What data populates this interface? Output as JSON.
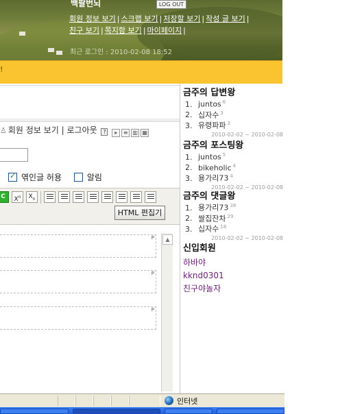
{
  "header": {
    "title": "백팔번뇌",
    "logout_label": "LOG OUT",
    "links_row1": [
      "회원 정보 보기",
      "스크랩 보기",
      "저장할 보기",
      "작성 글 보기"
    ],
    "links_row2": [
      "친구 보기",
      "쪽지함 보기",
      "마이페이지"
    ],
    "separator": "|",
    "last_login": "최근 로그인 : 2010-02-08 18:52"
  },
  "yellow_bar": {
    "marker": "!"
  },
  "member_bar": {
    "member_info": "회원 정보 보기",
    "separator": "|",
    "logout": "로그아웃",
    "help": "?"
  },
  "options": {
    "trackback_label": "엮인글 허용",
    "trackback_checked": true,
    "notify_label": "알림",
    "notify_checked": false
  },
  "toolbar": {
    "c_label": "C",
    "superscript_label": "X",
    "subscript_label": "X",
    "html_edit_label": "HTML 편집기"
  },
  "editor": {
    "block_marker": "P"
  },
  "sidebar": {
    "answer_kings": {
      "title": "금주의 답변왕",
      "items": [
        {
          "rank": "1.",
          "name": "juntos",
          "count": "6"
        },
        {
          "rank": "2.",
          "name": "십자수",
          "count": "3"
        },
        {
          "rank": "3.",
          "name": "유령파파",
          "count": "3"
        }
      ],
      "date": "2010-02-02 ~ 2010-02-08"
    },
    "posting_kings": {
      "title": "금주의 포스팅왕",
      "items": [
        {
          "rank": "1.",
          "name": "juntos",
          "count": "5"
        },
        {
          "rank": "2.",
          "name": "bikeholic",
          "count": "4"
        },
        {
          "rank": "3.",
          "name": "용가리73",
          "count": "4"
        }
      ],
      "date": "2010-02-02 ~ 2010-02-08"
    },
    "comment_kings": {
      "title": "금주의 댓글왕",
      "items": [
        {
          "rank": "1.",
          "name": "용가리73",
          "count": "38"
        },
        {
          "rank": "2.",
          "name": "쌀집잔차",
          "count": "29"
        },
        {
          "rank": "3.",
          "name": "십자수",
          "count": "18"
        }
      ],
      "date": "2010-02-02 ~ 2010-02-08"
    },
    "new_members": {
      "title": "신입회원",
      "names": [
        "하바야",
        "kknd0301",
        "친구야놀자"
      ]
    }
  },
  "statusbar": {
    "zone": "인터넷"
  },
  "colors": {
    "accent_yellow": "#f9c430",
    "member_link": "#6b1f7a",
    "taskbar_blue": "#245edb"
  }
}
